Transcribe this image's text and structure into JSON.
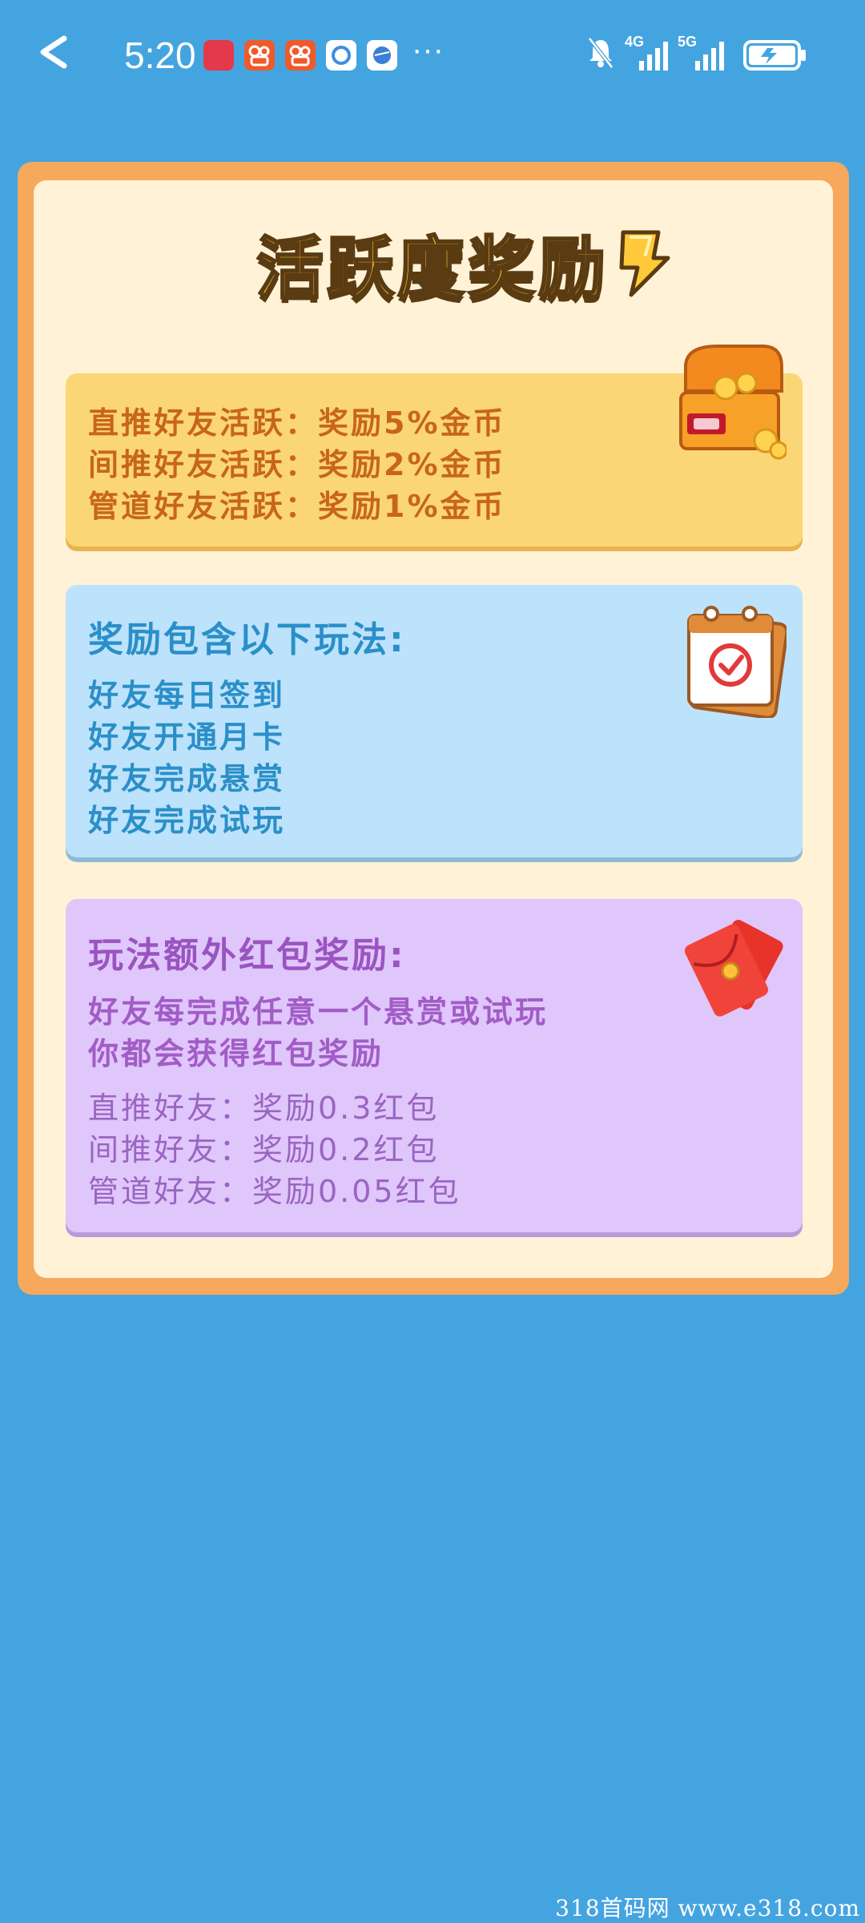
{
  "status_bar": {
    "time": "5:20",
    "more": "···",
    "network1": "4G",
    "network2": "5G",
    "app_icons": [
      "huawei-app-icon",
      "kuaishou-icon",
      "kuaishou-icon",
      "weather-icon",
      "browser-icon"
    ],
    "right_icons": [
      "mute-bell-icon",
      "signal-icon",
      "signal-icon",
      "battery-charging-icon"
    ]
  },
  "page": {
    "title": "活跃度奖励"
  },
  "active_rewards": {
    "lines": [
      "直推好友活跃：奖励5%金币",
      "间推好友活跃：奖励2%金币",
      "管道好友活跃：奖励1%金币"
    ]
  },
  "gameplay": {
    "title": "奖励包含以下玩法:",
    "items": [
      "好友每日签到",
      "好友开通月卡",
      "好友完成悬赏",
      "好友完成试玩"
    ]
  },
  "red_packet": {
    "title": "玩法额外红包奖励:",
    "desc": [
      "好友每完成任意一个悬赏或试玩",
      "你都会获得红包奖励"
    ],
    "lines": [
      "直推好友：奖励0.3红包",
      "间推好友：奖励0.2红包",
      "管道好友：奖励0.05红包"
    ]
  },
  "watermark": "318首码网  www.e318.com",
  "colors": {
    "background": "#44a4e0",
    "card_border": "#f6a85c",
    "card_fill": "#fff2d7",
    "yellow_box": "#fbd677",
    "blue_box": "#bde2fb",
    "purple_box": "#dfc6fb"
  }
}
